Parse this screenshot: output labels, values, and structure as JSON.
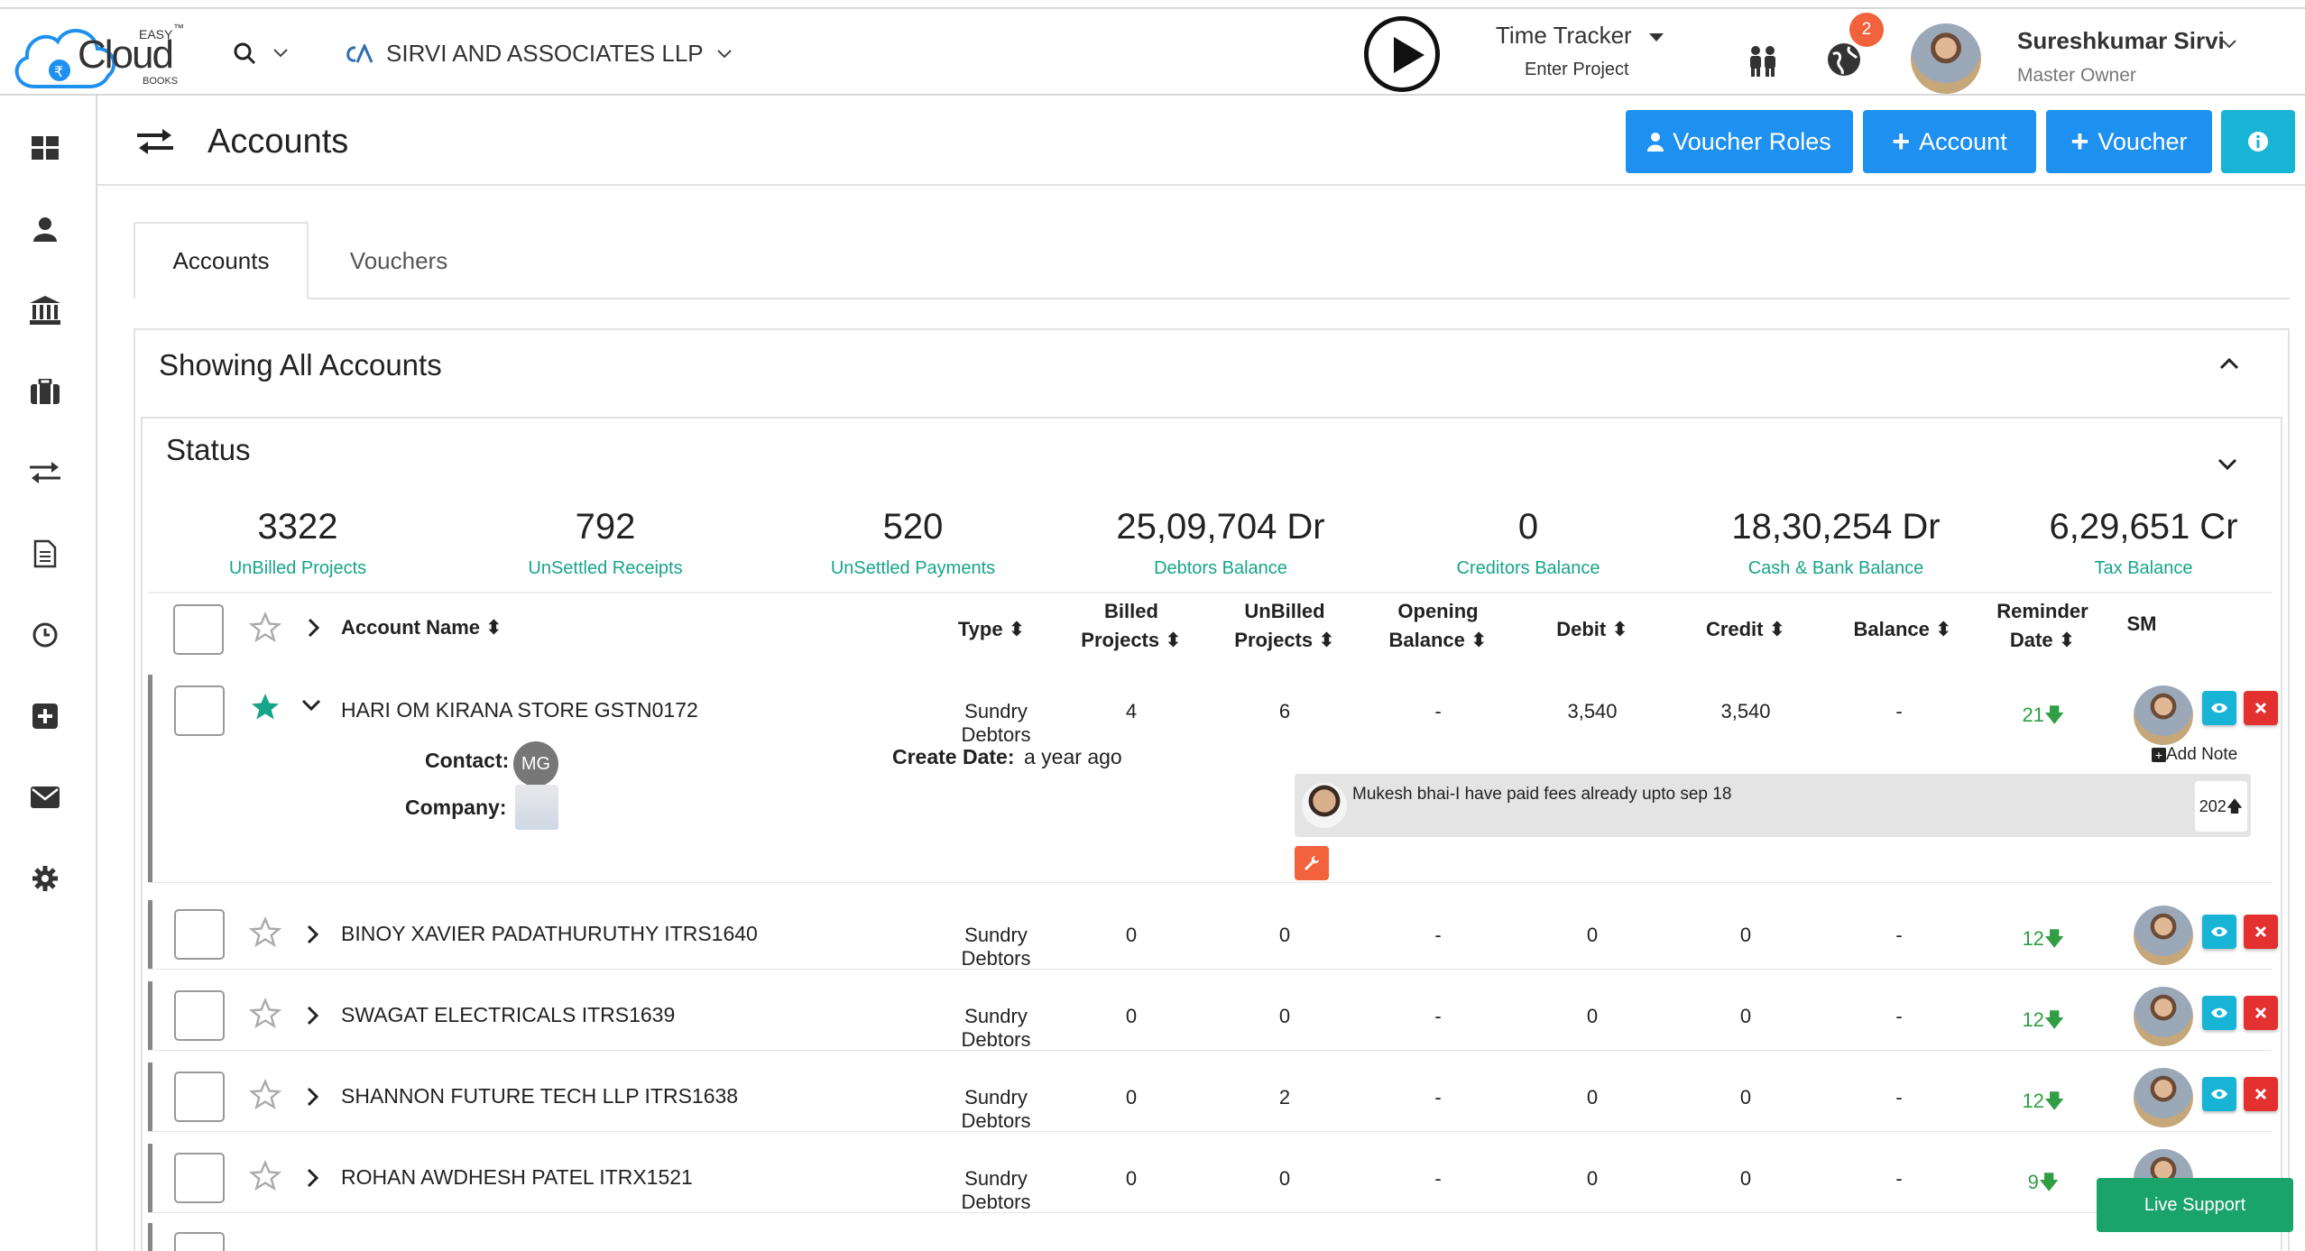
{
  "brand": {
    "logo_main": "Cloud",
    "logo_top": "EASY",
    "logo_bottom": "BOOKS",
    "logo_tm": "™"
  },
  "header": {
    "company": "SIRVI AND ASSOCIATES LLP",
    "time_tracker": {
      "title": "Time Tracker",
      "subtitle": "Enter Project"
    },
    "notifications_count": "2",
    "user": {
      "name": "Sureshkumar Sirvi",
      "role": "Master Owner"
    }
  },
  "sidebar": {
    "items": [
      "dashboard-icon",
      "user-icon",
      "bank-icon",
      "briefcase-icon",
      "exchange-icon",
      "document-icon",
      "clock-icon",
      "plus-square-icon",
      "envelope-icon",
      "gear-icon"
    ]
  },
  "page": {
    "title": "Accounts",
    "buttons": {
      "voucher_roles": "Voucher Roles",
      "account": "Account",
      "voucher": "Voucher"
    }
  },
  "tabs": [
    {
      "label": "Accounts",
      "active": true
    },
    {
      "label": "Vouchers",
      "active": false
    }
  ],
  "panel": {
    "title": "Showing All Accounts"
  },
  "status": {
    "title": "Status",
    "stats": [
      {
        "value": "3322",
        "label": "UnBilled Projects"
      },
      {
        "value": "792",
        "label": "UnSettled Receipts"
      },
      {
        "value": "520",
        "label": "UnSettled Payments"
      },
      {
        "value": "25,09,704 Dr",
        "label": "Debtors Balance"
      },
      {
        "value": "0",
        "label": "Creditors Balance"
      },
      {
        "value": "18,30,254 Dr",
        "label": "Cash & Bank Balance"
      },
      {
        "value": "6,29,651 Cr",
        "label": "Tax Balance"
      }
    ]
  },
  "table": {
    "columns": {
      "account_name": "Account Name",
      "type": "Type",
      "billed_1": "Billed",
      "billed_2": "Projects",
      "unbilled_1": "UnBilled",
      "unbilled_2": "Projects",
      "opening_1": "Opening",
      "opening_2": "Balance",
      "debit": "Debit",
      "credit": "Credit",
      "balance": "Balance",
      "reminder_1": "Reminder",
      "reminder_2": "Date",
      "sm": "SM"
    },
    "expanded": {
      "contact_label": "Contact:",
      "contact_initials": "MG",
      "company_label": "Company:",
      "create_label": "Create Date:",
      "create_value": "a year ago",
      "add_note": "Add Note",
      "note_text": "Mukesh bhai-I have paid fees already upto sep 18",
      "note_year": "202"
    },
    "rows": [
      {
        "name": "HARI OM KIRANA STORE GSTN0172",
        "type": "Sundry Debtors",
        "billed": "4",
        "unbilled": "6",
        "opening": "-",
        "debit": "3,540",
        "credit": "3,540",
        "balance": "-",
        "reminder": "21",
        "starred": true
      },
      {
        "name": "BINOY XAVIER PADATHURUTHY ITRS1640",
        "type": "Sundry Debtors",
        "billed": "0",
        "unbilled": "0",
        "opening": "-",
        "debit": "0",
        "credit": "0",
        "balance": "-",
        "reminder": "12",
        "starred": false
      },
      {
        "name": "SWAGAT ELECTRICALS ITRS1639",
        "type": "Sundry Debtors",
        "billed": "0",
        "unbilled": "0",
        "opening": "-",
        "debit": "0",
        "credit": "0",
        "balance": "-",
        "reminder": "12",
        "starred": false
      },
      {
        "name": "SHANNON FUTURE TECH LLP ITRS1638",
        "type": "Sundry Debtors",
        "billed": "0",
        "unbilled": "2",
        "opening": "-",
        "debit": "0",
        "credit": "0",
        "balance": "-",
        "reminder": "12",
        "starred": false
      },
      {
        "name": "ROHAN AWDHESH PATEL ITRX1521",
        "type": "Sundry Debtors",
        "billed": "0",
        "unbilled": "0",
        "opening": "-",
        "debit": "0",
        "credit": "0",
        "balance": "-",
        "reminder": "9",
        "starred": false
      }
    ]
  },
  "live_support": "Live Support",
  "colors": {
    "primary": "#1e90f0",
    "info": "#17b4d6",
    "danger": "#e4312f",
    "success": "#2f9e44",
    "teal": "#17a589",
    "badge": "#f2623c"
  }
}
